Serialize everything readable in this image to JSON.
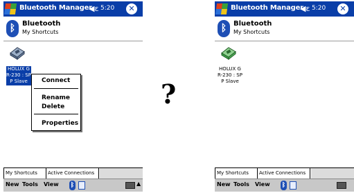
{
  "left_screen": {
    "titlebar": {
      "title": "Bluetooth Manager",
      "time": "5:20",
      "close_glyph": "✕"
    },
    "header": {
      "title": "Bluetooth",
      "subtitle": "My Shortcuts",
      "icon_glyph": "ᛒ"
    },
    "device": {
      "label": "HOLUX GR-230 : SPP Slave",
      "state": "selected",
      "icon": "gps-device-icon"
    },
    "context_menu": [
      "Connect",
      "Rename",
      "Delete",
      "Properties"
    ],
    "tabs": [
      "My Shortcuts",
      "Active Connections"
    ],
    "menubar": {
      "new": "New",
      "tools": "Tools",
      "view": "View",
      "bt_glyph": "ᛒ",
      "arrow_glyph": "▲"
    }
  },
  "right_screen": {
    "titlebar": {
      "title": "Bluetooth Manager",
      "time": "5:20",
      "close_glyph": "✕"
    },
    "header": {
      "title": "Bluetooth",
      "subtitle": "My Shortcuts",
      "icon_glyph": "ᛒ"
    },
    "device": {
      "label": "HOLUX GR-230 : SPP Slave",
      "state": "connected",
      "icon": "gps-device-connected-icon"
    },
    "tabs": [
      "My Shortcuts",
      "Active Connections"
    ],
    "menubar": {
      "new": "New",
      "tools": "Tools",
      "view": "View",
      "bt_glyph": "ᛒ"
    }
  },
  "question_mark": "?",
  "colors": {
    "titlebar": "#0a3ea8",
    "selection": "#0a3ea8",
    "device_gray": "#7a8fa8",
    "device_green": "#3fa34a"
  }
}
